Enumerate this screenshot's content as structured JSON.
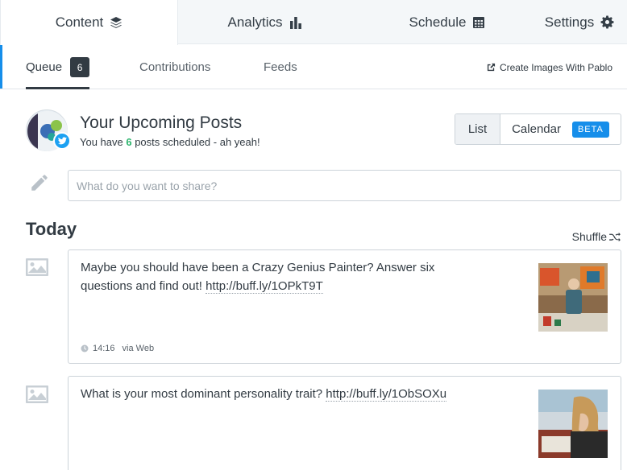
{
  "top_tabs": [
    {
      "label": "Content",
      "icon": "layers-icon",
      "active": true
    },
    {
      "label": "Analytics",
      "icon": "bar-chart-icon",
      "active": false
    },
    {
      "label": "Schedule",
      "icon": "calendar-icon",
      "active": false
    },
    {
      "label": "Settings",
      "icon": "gear-icon",
      "active": false
    }
  ],
  "sub_tabs": {
    "queue": "Queue",
    "queue_count": "6",
    "contributions": "Contributions",
    "feeds": "Feeds",
    "pablo": "Create Images With Pablo"
  },
  "header": {
    "title": "Your Upcoming Posts",
    "subtitle_pre": "You have ",
    "subtitle_count": "6",
    "subtitle_post": " posts scheduled - ah yeah!",
    "view_list": "List",
    "view_calendar": "Calendar",
    "beta": "BETA"
  },
  "composer": {
    "placeholder": "What do you want to share?"
  },
  "day": {
    "heading": "Today",
    "shuffle": "Shuffle"
  },
  "posts": [
    {
      "text": "Maybe you should have been a Crazy Genius Painter? Answer six questions and find out! ",
      "link": "http://buff.ly/1OPkT9T",
      "time": "14:16",
      "via": "via Web",
      "thumb": "painter-photo"
    },
    {
      "text": "What is your most dominant personality trait? ",
      "link": "http://buff.ly/1ObSOXu",
      "thumb": "reading-woman-photo"
    }
  ],
  "colors": {
    "accent": "#168eea",
    "positive": "#2fb56f",
    "twitter": "#1da1f2",
    "text": "#323b43"
  }
}
